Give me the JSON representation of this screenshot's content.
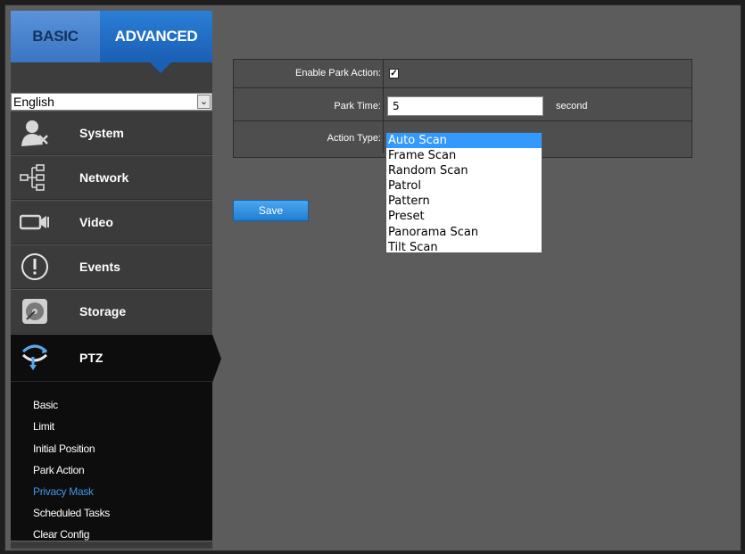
{
  "tabs": {
    "basic": "BASIC",
    "advanced": "ADVANCED"
  },
  "language": {
    "selected": "English"
  },
  "nav": {
    "system": "System",
    "network": "Network",
    "video": "Video",
    "events": "Events",
    "storage": "Storage",
    "ptz": "PTZ"
  },
  "submenu": [
    {
      "label": "Basic"
    },
    {
      "label": "Limit"
    },
    {
      "label": "Initial Position"
    },
    {
      "label": "Park Action"
    },
    {
      "label": "Privacy Mask"
    },
    {
      "label": "Scheduled Tasks"
    },
    {
      "label": "Clear Config"
    }
  ],
  "form": {
    "enable_park_label": "Enable Park Action:",
    "enable_park_checked": true,
    "park_time_label": "Park Time:",
    "park_time_value": "5",
    "park_time_unit": "second",
    "action_type_label": "Action Type:"
  },
  "action_options": [
    "Auto Scan",
    "Frame Scan",
    "Random Scan",
    "Patrol",
    "Pattern",
    "Preset",
    "Panorama Scan",
    "Tilt Scan"
  ],
  "action_selected": "Auto Scan",
  "save_label": "Save",
  "colors": {
    "accent": "#1a5fb4",
    "active_submenu": "#3f97e6",
    "selection": "#3399ff"
  }
}
